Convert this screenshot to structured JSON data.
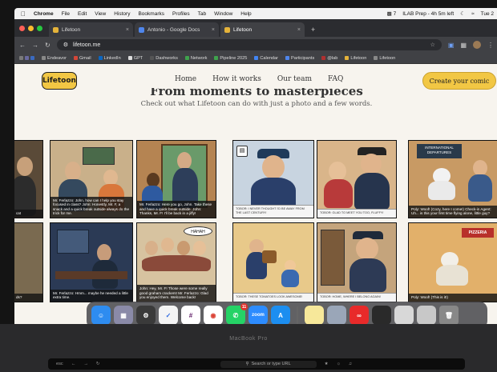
{
  "menubar": {
    "apple": "",
    "items": [
      "Chrome",
      "File",
      "Edit",
      "View",
      "History",
      "Bookmarks",
      "Profiles",
      "Tab",
      "Window",
      "Help"
    ],
    "right": [
      "7",
      "ILAB Prep - 4h 5m left",
      "Tue 2"
    ]
  },
  "tabs": [
    {
      "label": "Lifetoon"
    },
    {
      "label": "Antonio - Google Docs"
    },
    {
      "label": "Lifetoon"
    }
  ],
  "toolbar": {
    "url": "lifetoon.me"
  },
  "bookmarks": [
    "Endeavor",
    "Gmail",
    "LinkedIn",
    "GPT",
    "Dashworks",
    "Network",
    "Pipeline 2025",
    "Calendar",
    "Participants",
    "@lab",
    "Lifetoon",
    "Lifetoon"
  ],
  "page": {
    "logo": "Lifetoon",
    "nav": [
      "Home",
      "How it works",
      "Our team",
      "FAQ"
    ],
    "cta": "Create your comic",
    "hero_title": "From moments to masterpieces",
    "hero_sub": "Check out what Lifetoon can do with just a photo and a few words.",
    "captions": {
      "p1": "Mr. Ferlazzo: John, how can I help you stay focused in class? John: Honestly, Mr. F, a snack and a quick break outside always do the trick for me.",
      "p2": "Mr. Ferlazzo: Here you go, John. Take these and have a quick break outside. John: Thanks, Mr. F! I'll be back in a jiffy!",
      "p3": "Mr. Ferlazzo: Hmm... maybe he needed a little extra time.",
      "p4": "John: Hey, Mr. F! Those were some really good graham crackers! Mr. Ferlazzo: Glad you enjoyed them. Welcome back!",
      "p5": "TOBOR: I NEVER THOUGHT I'D BE AWAY FROM THE LAST CENTURY!",
      "p6": "TOBOR: GLAD TO MEET YOU TOO, FLUFFY!",
      "p7": "TOBOR: THESE TOMATOES LOOK AWESOME!",
      "p8": "TOBOR: HOME, WHERE I BELONG AGAIN!",
      "p9": "Poly: Woof! (Cozy, here I come!) Check-in Agent: Uh... is this your first time flying alone, little guy?",
      "p10": "Poly: Woof! (This is it!)",
      "left_edge_1": "cat",
      "left_edge_2": "ds?",
      "sign1": "INTERNATIONAL DEPARTURES",
      "sign2": "PIZZERIA",
      "sign3": "HAHAH"
    }
  },
  "dock": {
    "badge": "11",
    "zoom": "zoom"
  },
  "laptop": {
    "brand": "MacBook Pro",
    "touchbar_search": "Search or type URL"
  }
}
